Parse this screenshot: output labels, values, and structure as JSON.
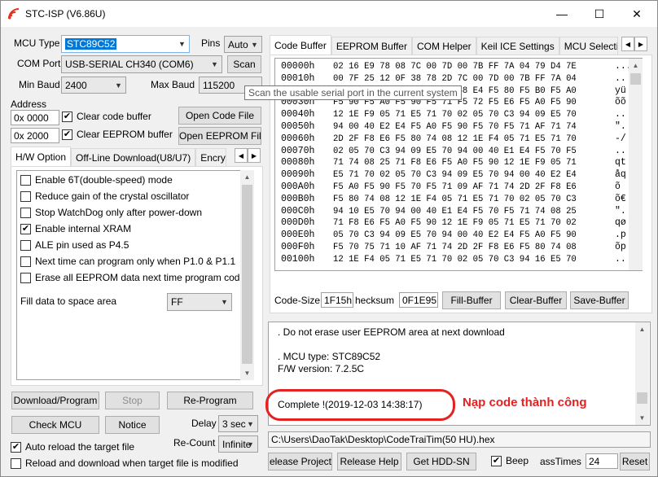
{
  "window": {
    "title": "STC-ISP (V6.86U)"
  },
  "titlebar": {
    "minimize": "—",
    "maximize": "☐",
    "close": "✕"
  },
  "left": {
    "mcu_type_label": "MCU Type",
    "mcu_type_value": "STC89C52",
    "pins_label": "Pins",
    "pins_value": "Auto",
    "com_port_label": "COM Port",
    "com_port_value": "USB-SERIAL CH340 (COM6)",
    "scan_label": "Scan",
    "min_baud_label": "Min Baud",
    "min_baud_value": "2400",
    "max_baud_label": "Max Baud",
    "max_baud_value": "115200",
    "address_label": "Address",
    "addr1_value": "0x 0000",
    "addr2_value": "0x 2000",
    "clear_code_label": "Clear code buffer",
    "clear_eeprom_label": "Clear EEPROM buffer",
    "open_code_label": "Open Code File",
    "open_eeprom_label": "Open EEPROM File",
    "tabs": [
      "H/W Option",
      "Off-Line Download(U8/U7)",
      "Encryp"
    ],
    "options": [
      {
        "label": "Enable 6T(double-speed) mode",
        "checked": false
      },
      {
        "label": "Reduce gain of the crystal oscillator",
        "checked": false
      },
      {
        "label": "Stop WatchDog only after power-down",
        "checked": false
      },
      {
        "label": "Enable internal XRAM",
        "checked": true
      },
      {
        "label": "ALE pin used as P4.5",
        "checked": false
      },
      {
        "label": "Next time can program only when P1.0 & P1.1",
        "checked": false
      },
      {
        "label": "Erase all EEPROM data next time program code",
        "checked": false
      }
    ],
    "fill_label": "Fill data to space area",
    "fill_value": "FF",
    "download_label": "Download/Program",
    "stop_label": "Stop",
    "reprogram_label": "Re-Program",
    "check_mcu_label": "Check MCU",
    "notice_label": "Notice",
    "delay_label": "Delay",
    "delay_value": "3 sec",
    "recount_label": "Re-Count",
    "recount_value": "Infinite",
    "auto_reload_label": "Auto reload the target file",
    "reload_download_label": "Reload and download when target file is modified"
  },
  "tooltip": {
    "text": "Scan the usable serial port in the current system"
  },
  "right": {
    "tabs": [
      "Code Buffer",
      "EEPROM Buffer",
      "COM Helper",
      "Keil ICE Settings",
      "MCU Selecti"
    ],
    "hex_rows": [
      {
        "addr": "00000h",
        "bytes": "02 16 E9 78 08 7C 00 7D 00 7B FF 7A 04 79 D4 7E",
        "ascii": "..."
      },
      {
        "addr": "00010h",
        "bytes": "00 7F 25 12 0F 38 78 2D 7C 00 7D 00 7B FF 7A 04",
        "ascii": ".."
      },
      {
        "addr": "00020h",
        "bytes": "79 01 7E 00 7F 25 12 0F 38 E4 F5 80 F5 B0 F5 A0",
        "ascii": "yü"
      },
      {
        "addr": "00030h",
        "bytes": "F5 90 F5 A0 F5 90 F5 71 F5 72 F5 E6 F5 A0 F5 90",
        "ascii": "õõ"
      },
      {
        "addr": "00040h",
        "bytes": "12 1E F9 05 71 E5 71 70 02 05 70 C3 94 09 E5 70",
        "ascii": ".."
      },
      {
        "addr": "00050h",
        "bytes": "94 00 40 E2 E4 F5 A0 F5 90 F5 70 F5 71 AF 71 74",
        "ascii": "\"."
      },
      {
        "addr": "00060h",
        "bytes": "2D 2F F8 E6 F5 80 74 08 12 1E F4 05 71 E5 71 70",
        "ascii": "-/"
      },
      {
        "addr": "00070h",
        "bytes": "02 05 70 C3 94 09 E5 70 94 00 40 E1 E4 F5 70 F5",
        "ascii": ".."
      },
      {
        "addr": "00080h",
        "bytes": "71 74 08 25 71 F8 E6 F5 A0 F5 90 12 1E F9 05 71",
        "ascii": "qt"
      },
      {
        "addr": "00090h",
        "bytes": "E5 71 70 02 05 70 C3 94 09 E5 70 94 00 40 E2 E4",
        "ascii": "åq"
      },
      {
        "addr": "000A0h",
        "bytes": "F5 A0 F5 90 F5 70 F5 71 09 AF 71 74 2D 2F F8 E6",
        "ascii": "õ"
      },
      {
        "addr": "000B0h",
        "bytes": "F5 80 74 08 12 1E F4 05 71 E5 71 70 02 05 70 C3",
        "ascii": "õ€"
      },
      {
        "addr": "000C0h",
        "bytes": "94 10 E5 70 94 00 40 E1 E4 F5 70 F5 71 74 08 25",
        "ascii": "\"."
      },
      {
        "addr": "000D0h",
        "bytes": "71 F8 E6 F5 A0 F5 90 12 1E F9 05 71 E5 71 70 02",
        "ascii": "qø"
      },
      {
        "addr": "000E0h",
        "bytes": "05 70 C3 94 09 E5 70 94 00 40 E2 E4 F5 A0 F5 90",
        "ascii": ".p"
      },
      {
        "addr": "000F0h",
        "bytes": "F5 70 75 71 10 AF 71 74 2D 2F F8 E6 F5 80 74 08",
        "ascii": "õp"
      },
      {
        "addr": "00100h",
        "bytes": "12 1E F4 05 71 E5 71 70 02 05 70 C3 94 16 E5 70",
        "ascii": ".."
      }
    ],
    "code_size_label": "Code-Size",
    "code_size_value": "1F15h",
    "checksum_label": "hecksum",
    "checksum_value": "0F1E95",
    "fill_buffer_label": "Fill-Buffer",
    "clear_buffer_label": "Clear-Buffer",
    "save_buffer_label": "Save-Buffer",
    "log_lines": [
      ". Do not erase user EEPROM area at next download",
      "",
      ". MCU type: STC89C52",
      "F/W version: 7.2.5C",
      "",
      "Complete !(2019-12-03 14:38:17)"
    ],
    "annotation": "Nạp code thành công",
    "file_path": "C:\\Users\\DaoTak\\Desktop\\CodeTraiTim(50 HU).hex",
    "release_project_label": "Release Project",
    "release_help_label": "Release Help",
    "get_hdd_label": "Get HDD-SN",
    "beep_label": "Beep",
    "pass_times_label": "assTimes",
    "pass_times_value": "24",
    "reset_label": "Reset"
  }
}
